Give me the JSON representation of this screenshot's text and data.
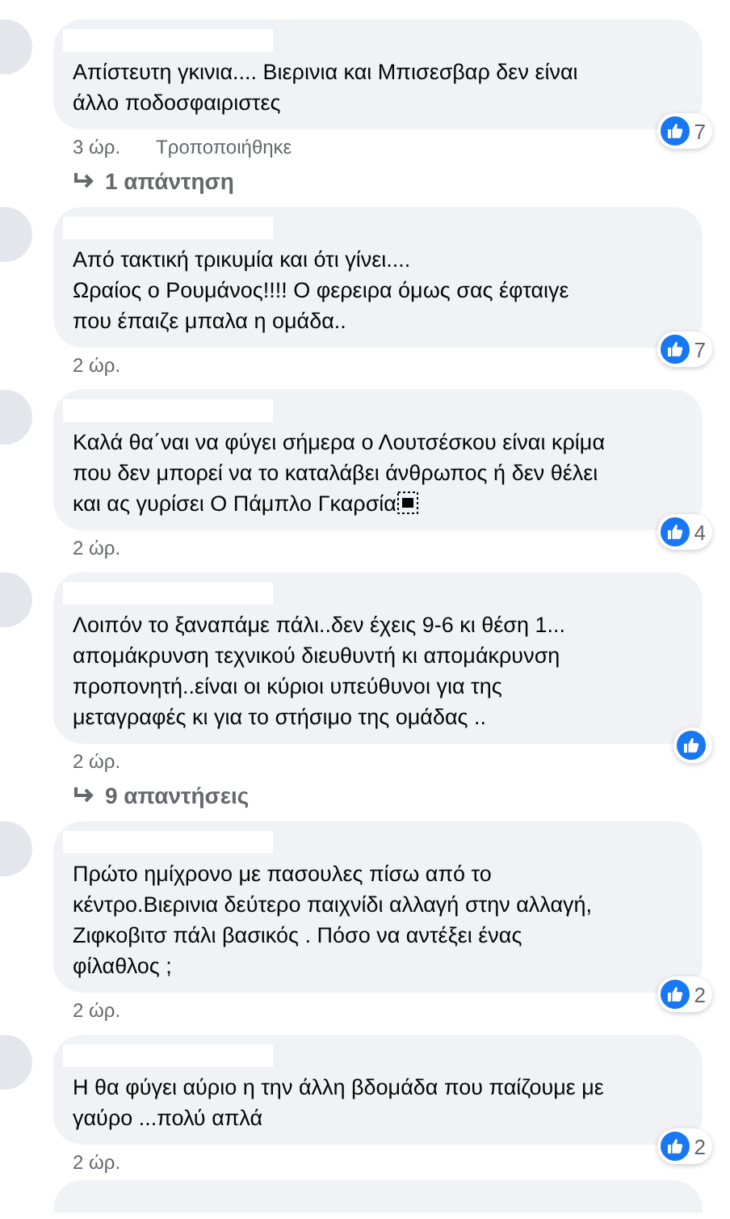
{
  "comments": [
    {
      "text": "Απίστευτη γκινια.... Βιερινια και Μπισεσβαρ δεν είναι\nάλλο ποδοσφαιριστες",
      "time": "3 ώρ.",
      "edited_label": "Τροποποιήθηκε",
      "reaction_count": "7",
      "replies": "1 απάντηση"
    },
    {
      "text": "Από τακτική τρικυμία και ότι γίνει....\nΩραίος ο Ρουμάνος!!!! Ο φερειρα όμως σας έφταιγε\nπου έπαιζε μπαλα η ομάδα..",
      "time": "2 ώρ.",
      "reaction_count": "7"
    },
    {
      "text": "Καλά θα΄ναι να φύγει σήμερα ο Λουτσέσκου είναι κρίμα\nπου δεν μπορεί να το καταλάβει άνθρωπος ή δεν θέλει\nκαι ας γυρίσει Ο Πάμπλο Γκαρσία",
      "time": "2 ώρ.",
      "reaction_count": "4",
      "trailing_symbol": true
    },
    {
      "text": "Λοιπόν το ξαναπάμε πάλι..δεν έχεις 9-6 κι θέση 1...\nαπομάκρυνση τεχνικού διευθυντή κι απομάκρυνση\nπροπονητή..είναι οι κύριοι υπεύθυνοι για της\nμεταγραφές κι για το στήσιμο της ομάδας ..",
      "time": "2 ώρ.",
      "replies": "9 απαντήσεις"
    },
    {
      "text": "Πρώτο ημίχρονο με πασουλες πίσω από το\nκέντρο.Βιερινια δεύτερο παιχνίδι αλλαγή στην αλλαγή,\nΖιφκοβιτσ πάλι βασικός . Πόσο να αντέξει ένας\nφίλαθλος ;",
      "time": "2 ώρ.",
      "reaction_count": "2"
    },
    {
      "text": "Η θα φύγει αύριο η την άλλη βδομάδα που παίζουμε με\nγαύρο ...πολύ απλά",
      "time": "2 ώρ.",
      "reaction_count": "2"
    }
  ]
}
